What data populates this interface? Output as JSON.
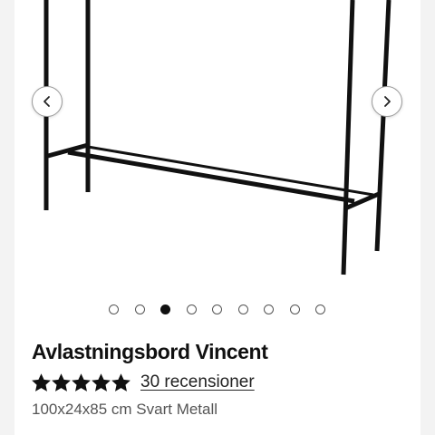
{
  "product": {
    "title": "Avlastningsbord Vincent",
    "rating": 5,
    "rating_max": 5,
    "reviews_label": "30 recensioner",
    "subtitle": "100x24x85 cm Svart Metall"
  },
  "gallery": {
    "prev_icon": "chevron-left-icon",
    "next_icon": "chevron-right-icon",
    "image_count": 9,
    "active_index": 2
  },
  "colors": {
    "frame": "#111111",
    "star": "#111111",
    "background": "#f3f3f3",
    "card": "#ffffff"
  }
}
